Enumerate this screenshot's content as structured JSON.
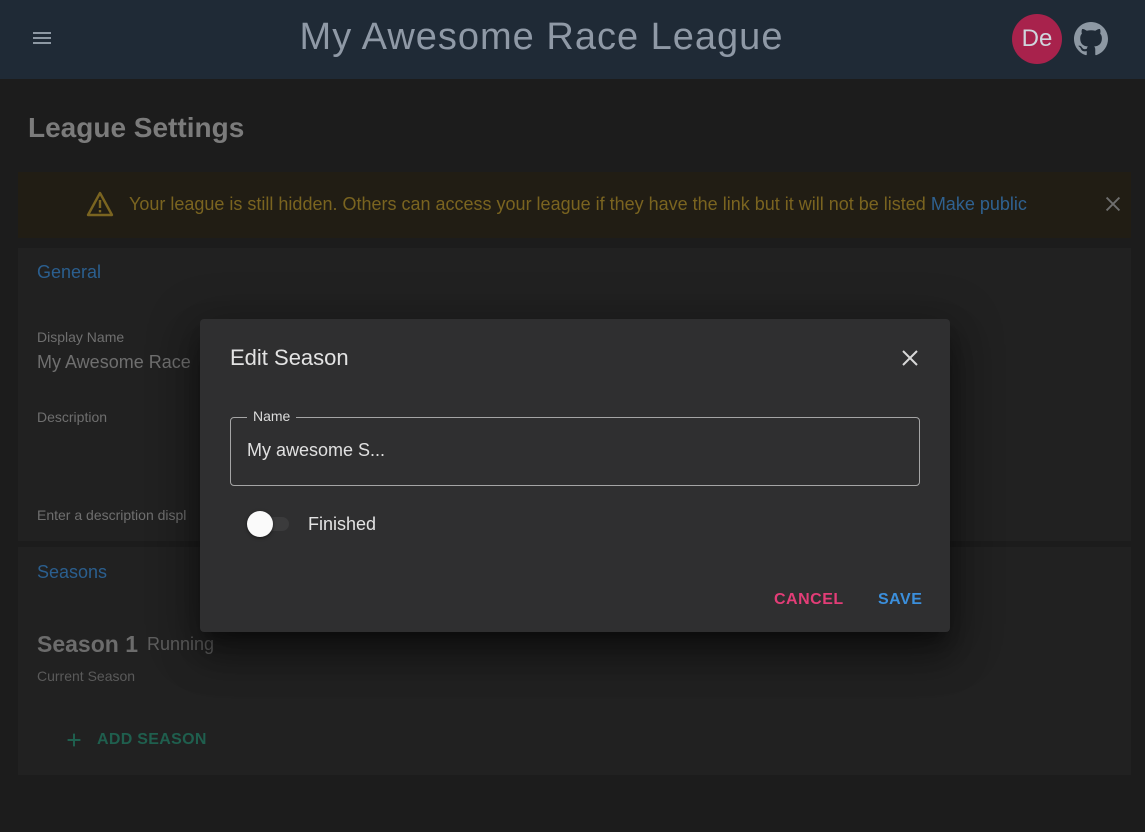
{
  "appbar": {
    "title": "My Awesome Race League",
    "avatar_initials": "De",
    "menu_icon": "menu-icon",
    "github_icon": "github-icon",
    "background": "#1f2a36",
    "avatar_color": "#a8224c"
  },
  "page": {
    "title": "League Settings"
  },
  "alert": {
    "message": "Your league is still hidden. Others can access your league if they have the link but it will not be listed",
    "link_label": "Make public",
    "icon": "warning-icon",
    "close_icon": "close-icon"
  },
  "general": {
    "heading": "General",
    "display_name_label": "Display Name",
    "display_name_value": "My Awesome Race",
    "description_label": "Description",
    "description_hint": "Enter a description displ"
  },
  "seasons": {
    "heading": "Seasons",
    "items": [
      {
        "name": "Season 1",
        "status": "Running",
        "subtitle": "Current Season"
      }
    ],
    "add_label": "ADD SEASON",
    "accent": "#1f5f4e"
  },
  "dialog": {
    "title": "Edit Season",
    "name_label": "Name",
    "name_value": "My awesome S...",
    "finished_label": "Finished",
    "finished_checked": false,
    "cancel_label": "CANCEL",
    "save_label": "SAVE",
    "cancel_color": "#e33d77",
    "save_color": "#3b8fdc"
  }
}
